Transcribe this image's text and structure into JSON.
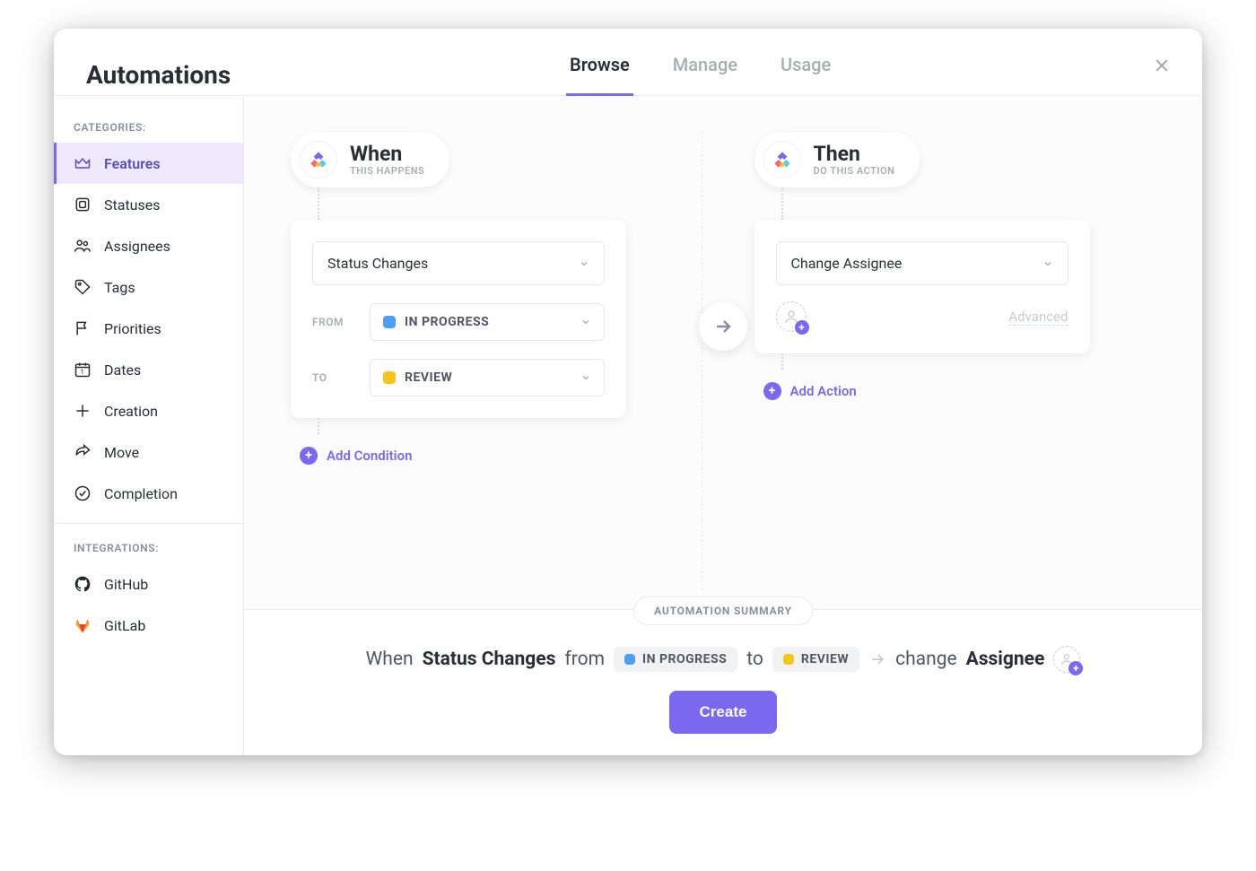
{
  "header": {
    "title": "Automations",
    "tabs": {
      "browse": "Browse",
      "manage": "Manage",
      "usage": "Usage"
    }
  },
  "sidebar": {
    "categories_label": "CATEGORIES:",
    "integrations_label": "INTEGRATIONS:",
    "items": {
      "features": "Features",
      "statuses": "Statuses",
      "assignees": "Assignees",
      "tags": "Tags",
      "priorities": "Priorities",
      "dates": "Dates",
      "creation": "Creation",
      "move": "Move",
      "completion": "Completion"
    },
    "integrations": {
      "github": "GitHub",
      "gitlab": "GitLab"
    }
  },
  "builder": {
    "when": {
      "title": "When",
      "sub": "THIS HAPPENS"
    },
    "then": {
      "title": "Then",
      "sub": "DO THIS ACTION"
    },
    "trigger_select": "Status Changes",
    "from_label": "FROM",
    "to_label": "TO",
    "from_status": {
      "text": "IN PROGRESS",
      "color": "#4f9cf9"
    },
    "to_status": {
      "text": "REVIEW",
      "color": "#f5c518"
    },
    "add_condition": "Add Condition",
    "action_select": "Change Assignee",
    "advanced": "Advanced",
    "add_action": "Add Action"
  },
  "summary": {
    "badge": "AUTOMATION SUMMARY",
    "when_word": "When",
    "status_changes": "Status Changes",
    "from_word": "from",
    "to_word": "to",
    "change_word": "change",
    "assignee_word": "Assignee",
    "create_btn": "Create"
  }
}
